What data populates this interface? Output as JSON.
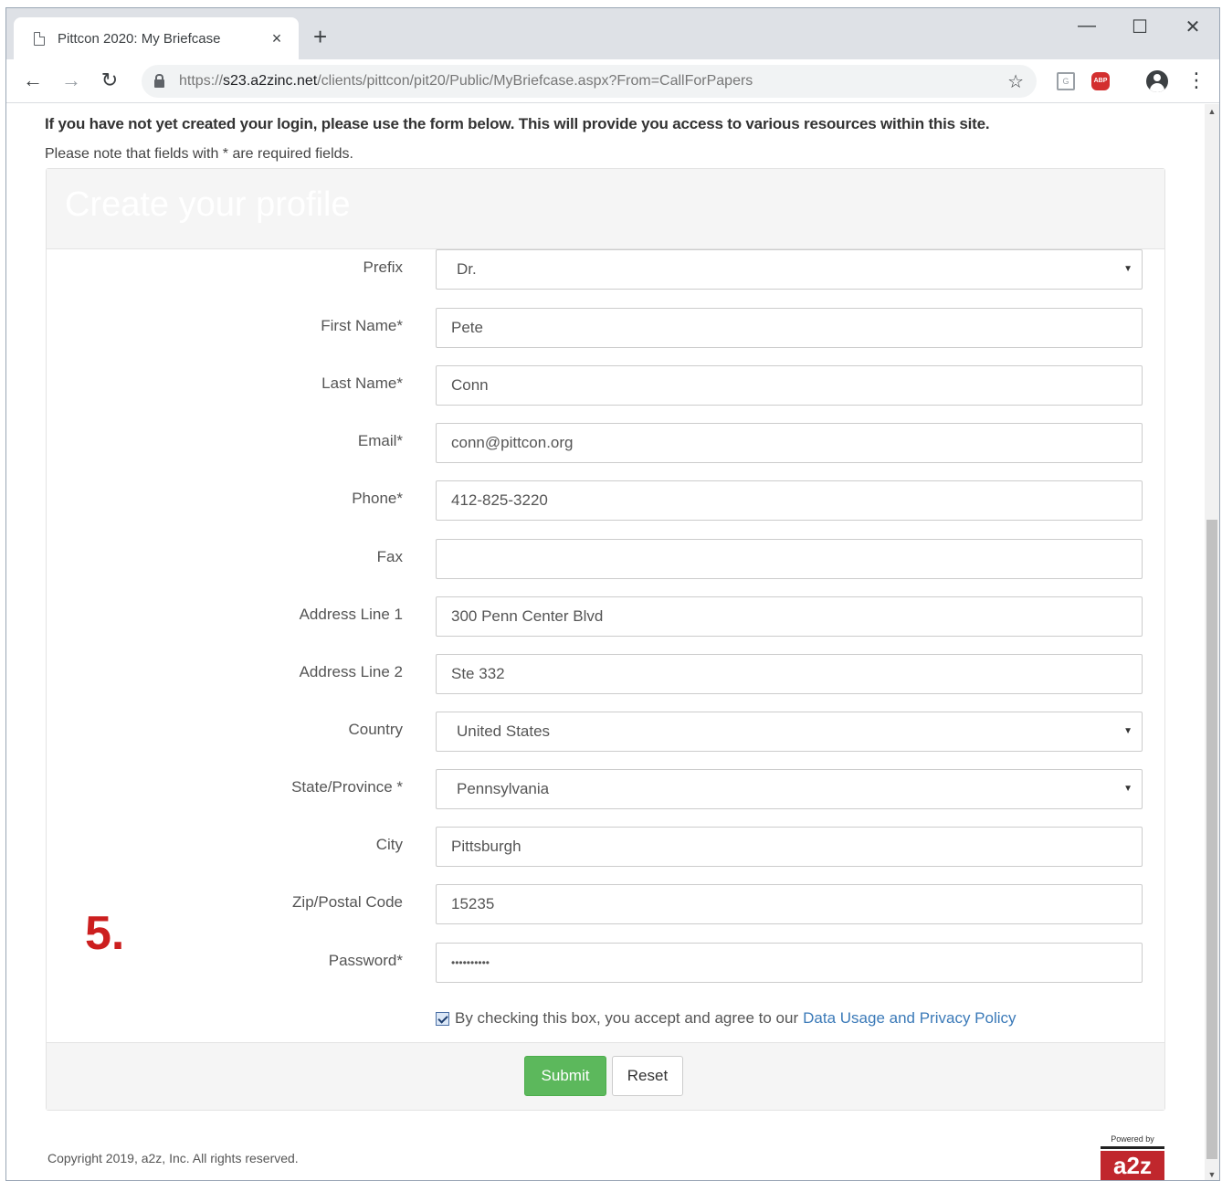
{
  "browser": {
    "tab_title": "Pittcon 2020: My Briefcase",
    "tab_close": "×",
    "new_tab": "+",
    "minimize": "—",
    "maximize": "☐",
    "close": "✕",
    "back": "←",
    "forward": "→",
    "reload": "↻",
    "url_scheme": "https://",
    "url_host": "s23.a2zinc.net",
    "url_path": "/clients/pittcon/pit20/Public/MyBriefcase.aspx?From=CallForPapers",
    "bookmark": "☆",
    "menu": "⋮"
  },
  "page": {
    "intro": "If you have not yet created your login, please use the form below. This will provide you access to various resources within this site.",
    "note": "Please note that fields with * are required fields.",
    "panel_title": "Create your profile"
  },
  "form": {
    "fields": [
      {
        "label": "Prefix",
        "value": "Dr.",
        "type": "select"
      },
      {
        "label": "First Name*",
        "value": "Pete",
        "type": "text"
      },
      {
        "label": "Last Name*",
        "value": "Conn",
        "type": "text"
      },
      {
        "label": "Email*",
        "value": "conn@pittcon.org",
        "type": "text"
      },
      {
        "label": "Phone*",
        "value": "412-825-3220",
        "type": "text"
      },
      {
        "label": "Fax",
        "value": "",
        "type": "text"
      },
      {
        "label": "Address Line 1",
        "value": "300 Penn Center Blvd",
        "type": "text"
      },
      {
        "label": "Address Line 2",
        "value": "Ste 332",
        "type": "text"
      },
      {
        "label": "Country",
        "value": "United States",
        "type": "select"
      },
      {
        "label": "State/Province *",
        "value": "Pennsylvania",
        "type": "select"
      },
      {
        "label": "City",
        "value": "Pittsburgh",
        "type": "text"
      },
      {
        "label": "Zip/Postal Code",
        "value": "15235",
        "type": "text"
      },
      {
        "label": "Password*",
        "value": "••••••••••",
        "type": "password"
      }
    ],
    "consent_text": "By checking this box, you accept and agree to our",
    "consent_link": "Data Usage and Privacy Policy",
    "consent_checked": true,
    "submit_label": "Submit",
    "reset_label": "Reset"
  },
  "annotation": {
    "step": "5."
  },
  "footer": {
    "copyright": "Copyright 2019, a2z, Inc. All rights reserved.",
    "powered_by": "Powered by",
    "logo": "a2z"
  },
  "colors": {
    "submit": "#5cb85c",
    "link": "#3b7ab8",
    "step_marker": "#cc1f1f",
    "logo": "#c0272d"
  }
}
